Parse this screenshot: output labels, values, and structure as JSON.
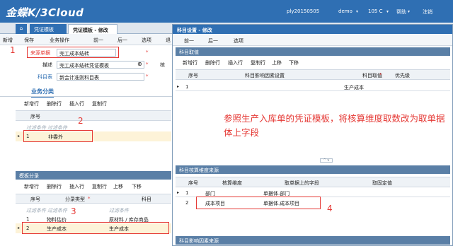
{
  "app": {
    "logo": "金蝶K/3Cloud",
    "user_code": "ply20150505",
    "user": "demo",
    "org": "105 C",
    "help": "帮助",
    "logout": "注销"
  },
  "tabs": {
    "voucher_template": "凭证模板",
    "voucher_template_edit": "凭证模板 - 修改"
  },
  "toolbar": {
    "items": [
      "新增",
      "保存",
      "业务操作",
      "前一",
      "后一",
      "选项",
      "退"
    ]
  },
  "header": {
    "source_label": "来源单据",
    "source_value": "完工成本结转",
    "desc_label": "描述",
    "desc_value": "完工成本结转凭证模板",
    "subject_table_label": "科目表",
    "subject_table_value": "新会计准则科目表",
    "check_label": "核"
  },
  "business_category": {
    "tab_label": "业务分类",
    "toolbar": [
      "新增行",
      "删除行",
      "插入行",
      "复制行"
    ],
    "columns": [
      "序号"
    ],
    "filter_text": "过滤条件",
    "rows": [
      {
        "seq": "1",
        "name": "非委外"
      }
    ]
  },
  "template_entry": {
    "section_title": "模板分录",
    "toolbar": [
      "新增行",
      "删除行",
      "插入行",
      "复制行",
      "上移",
      "下移"
    ],
    "columns": [
      "序号",
      "分录类型",
      "科目"
    ],
    "filter_text": "过滤条件",
    "rows": [
      {
        "seq": "1",
        "type": "物料估价",
        "subject": "原材料 / 库存商品"
      },
      {
        "seq": "2",
        "type": "生产成本",
        "subject": "生产成本"
      }
    ]
  },
  "dialog": {
    "title": "科目设置 - 修改",
    "toolbar": [
      "前一",
      "后一",
      "选项"
    ],
    "subject_section": "科目取值",
    "subject_toolbar": [
      "新增行",
      "删除行",
      "插入行",
      "复制行",
      "上移",
      "下移"
    ],
    "subject_columns": [
      "序号",
      "科目影响因素设置",
      "科目取值",
      "优先级"
    ],
    "subject_rows": [
      {
        "seq": "1",
        "factor": "",
        "value": "生产成本",
        "priority": ""
      }
    ],
    "note": "参照生产入库单的凭证模板，将核算维度取数改为取单据体上字段",
    "dim_section": "科目核算维度来源",
    "dim_columns": [
      "序号",
      "核算维度",
      "取单据上的字段",
      "取固定值"
    ],
    "dim_rows": [
      {
        "seq": "1",
        "dim": "部门",
        "field": "单据体.部门",
        "fixed": ""
      },
      {
        "seq": "2",
        "dim": "成本项目",
        "field": "单据体.成本项目",
        "fixed": ""
      }
    ],
    "bottom_section": "科目影响因素来源"
  },
  "annotations": {
    "n1": "1",
    "n2": "2",
    "n3": "3",
    "n4": "4"
  },
  "colors": {
    "header_blue": "#2f6fb3",
    "section_blue": "#5a7fa6",
    "annotation_red": "#e53935"
  }
}
